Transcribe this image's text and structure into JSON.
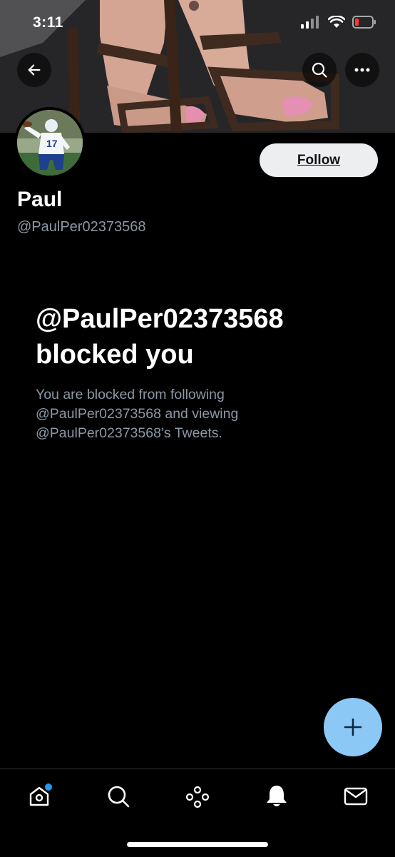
{
  "status_bar": {
    "time": "3:11",
    "icons": [
      "cellular-signal-icon",
      "wifi-icon",
      "battery-low-icon"
    ],
    "battery_color": "#ff3b30"
  },
  "header": {
    "back_icon": "arrow-left-icon",
    "search_icon": "search-icon",
    "more_icon": "more-dots-icon"
  },
  "profile": {
    "display_name": "Paul",
    "handle": "@PaulPer02373568",
    "follow_label": "Follow"
  },
  "blocked": {
    "title_line1": "@PaulPer02373568",
    "title_line2": "blocked you",
    "desc_line1": "You are blocked from following",
    "desc_line2": "@PaulPer02373568 and viewing",
    "desc_line3": "@PaulPer02373568’s Tweets."
  },
  "fab": {
    "icon": "plus-icon",
    "color": "#8cc8f5"
  },
  "tab_bar": {
    "tabs": [
      {
        "icon": "home-icon",
        "has_dot": true,
        "dot_color": "#1d9bf0"
      },
      {
        "icon": "search-icon"
      },
      {
        "icon": "spaces-icon"
      },
      {
        "icon": "bell-icon",
        "active": true
      },
      {
        "icon": "mail-icon"
      }
    ]
  },
  "colors": {
    "background": "#000000",
    "secondary_text": "#8b98a5",
    "accent": "#1d9bf0"
  }
}
